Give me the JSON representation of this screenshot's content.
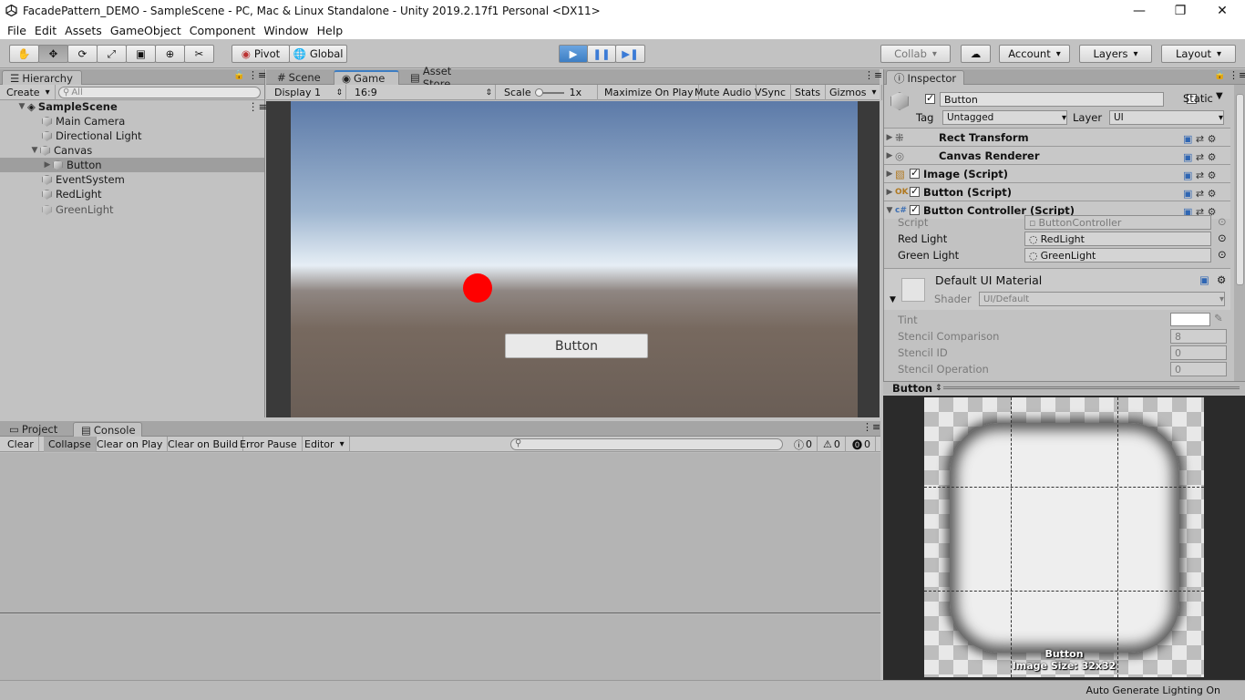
{
  "window": {
    "title": "FacadePattern_DEMO - SampleScene - PC, Mac & Linux Standalone - Unity 2019.2.17f1 Personal <DX11>",
    "minimize": "—",
    "maximize": "❐",
    "close": "✕"
  },
  "menu": [
    "File",
    "Edit",
    "Assets",
    "GameObject",
    "Component",
    "Window",
    "Help"
  ],
  "toolbar": {
    "tools": [
      "hand-tool",
      "move-tool",
      "rotate-tool",
      "scale-tool",
      "rect-tool",
      "transform-tool",
      "custom-tool"
    ],
    "pivot": "Pivot",
    "global": "Global",
    "collab": "Collab",
    "account": "Account",
    "layers": "Layers",
    "layout": "Layout"
  },
  "hierarchy": {
    "tab": "Hierarchy",
    "create": "Create",
    "search_placeholder": "All",
    "scene": "SampleScene",
    "items": [
      "Main Camera",
      "Directional Light",
      "Canvas",
      "Button",
      "EventSystem",
      "RedLight",
      "GreenLight"
    ]
  },
  "center": {
    "tabs": [
      "Scene",
      "Game",
      "Asset Store"
    ],
    "game_bar": {
      "display": "Display 1",
      "aspect": "16:9",
      "scale_label": "Scale",
      "scale_value": "1x",
      "maximize": "Maximize On Play",
      "mute": "Mute Audio",
      "vsync": "VSync",
      "stats": "Stats",
      "gizmos": "Gizmos"
    },
    "game_button_label": "Button",
    "red_light_color": "#ff0000"
  },
  "console": {
    "tabs": [
      "Project",
      "Console"
    ],
    "buttons": [
      "Clear",
      "Collapse",
      "Clear on Play",
      "Clear on Build",
      "Error Pause",
      "Editor"
    ],
    "counts": {
      "info": "0",
      "warning": "0",
      "error": "0"
    }
  },
  "inspector": {
    "tab": "Inspector",
    "object_name": "Button",
    "static_label": "Static",
    "tag_label": "Tag",
    "tag_value": "Untagged",
    "layer_label": "Layer",
    "layer_value": "UI",
    "components": [
      "Rect Transform",
      "Canvas Renderer",
      "Image (Script)",
      "Button (Script)",
      "Button Controller (Script)"
    ],
    "script_label": "Script",
    "script_value": "ButtonController",
    "red_label": "Red Light",
    "red_value": "RedLight",
    "green_label": "Green Light",
    "green_value": "GreenLight",
    "material_name": "Default UI Material",
    "shader_label": "Shader",
    "shader_value": "UI/Default",
    "tint_label": "Tint",
    "stencil_comp_label": "Stencil Comparison",
    "stencil_comp_value": "8",
    "stencil_id_label": "Stencil ID",
    "stencil_id_value": "0",
    "stencil_op_label": "Stencil Operation",
    "stencil_op_value": "0"
  },
  "preview": {
    "header": "Button",
    "caption_name": "Button",
    "caption_size": "Image Size: 32x32"
  },
  "status": "Auto Generate Lighting On"
}
